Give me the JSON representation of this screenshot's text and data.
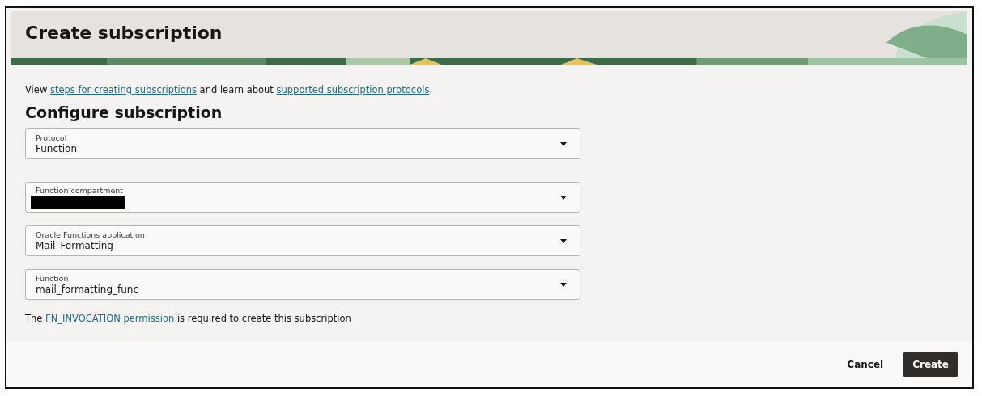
{
  "header": {
    "title": "Create subscription"
  },
  "intro": {
    "parts": [
      {
        "kind": "text",
        "text": "View "
      },
      {
        "kind": "link",
        "text": "steps for creating subscriptions"
      },
      {
        "kind": "text",
        "text": " and learn about "
      },
      {
        "kind": "link",
        "text": "supported subscription protocols"
      },
      {
        "kind": "text",
        "text": "."
      }
    ]
  },
  "section_title": "Configure subscription",
  "fields": [
    {
      "kind": "select",
      "label": "Protocol",
      "value": "Function"
    },
    {
      "kind": "redacted",
      "label": "Function compartment"
    },
    {
      "kind": "select",
      "label": "Oracle Functions application",
      "value": "Mail_Formatting"
    },
    {
      "kind": "select",
      "label": "Function",
      "value": "mail_formatting_func"
    }
  ],
  "note": {
    "parts": [
      {
        "kind": "text",
        "text": "The "
      },
      {
        "kind": "link",
        "text": "FN_INVOCATION permission"
      },
      {
        "kind": "text",
        "text": " is required to create this subscription"
      }
    ]
  },
  "buttons": [
    {
      "kind": "secondary",
      "label": "Cancel"
    },
    {
      "kind": "primary",
      "label": "Create"
    }
  ]
}
